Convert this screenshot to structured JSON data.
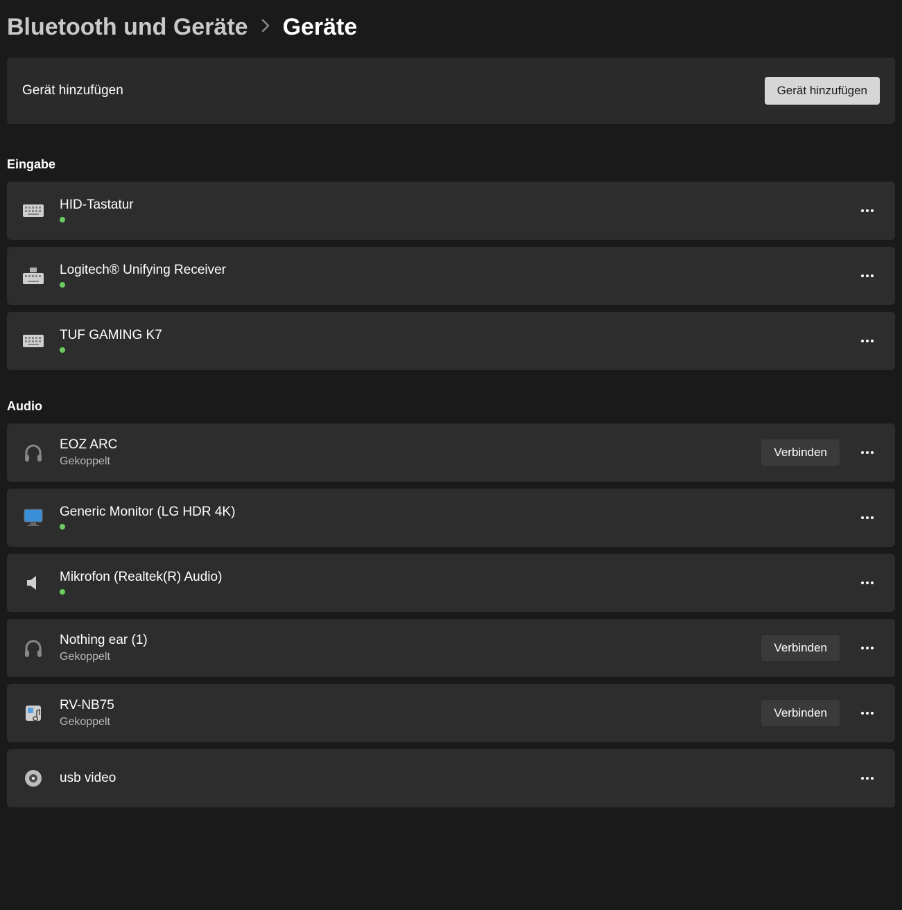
{
  "breadcrumb": {
    "parent": "Bluetooth und Geräte",
    "current": "Geräte"
  },
  "addCard": {
    "label": "Gerät hinzufügen",
    "button": "Gerät hinzufügen"
  },
  "labels": {
    "connect": "Verbinden",
    "paired": "Gekoppelt"
  },
  "sections": {
    "input": {
      "title": "Eingabe",
      "devices": [
        {
          "name": "HID-Tastatur",
          "statusDot": true
        },
        {
          "name": "Logitech® Unifying Receiver",
          "statusDot": true
        },
        {
          "name": "TUF GAMING K7",
          "statusDot": true
        }
      ]
    },
    "audio": {
      "title": "Audio",
      "devices": [
        {
          "name": "EOZ ARC",
          "statusText": "Gekoppelt",
          "connect": true
        },
        {
          "name": "Generic Monitor (LG HDR 4K)",
          "statusDot": true
        },
        {
          "name": "Mikrofon (Realtek(R) Audio)",
          "statusDot": true
        },
        {
          "name": "Nothing ear (1)",
          "statusText": "Gekoppelt",
          "connect": true
        },
        {
          "name": "RV-NB75",
          "statusText": "Gekoppelt",
          "connect": true
        },
        {
          "name": "usb video"
        }
      ]
    }
  }
}
